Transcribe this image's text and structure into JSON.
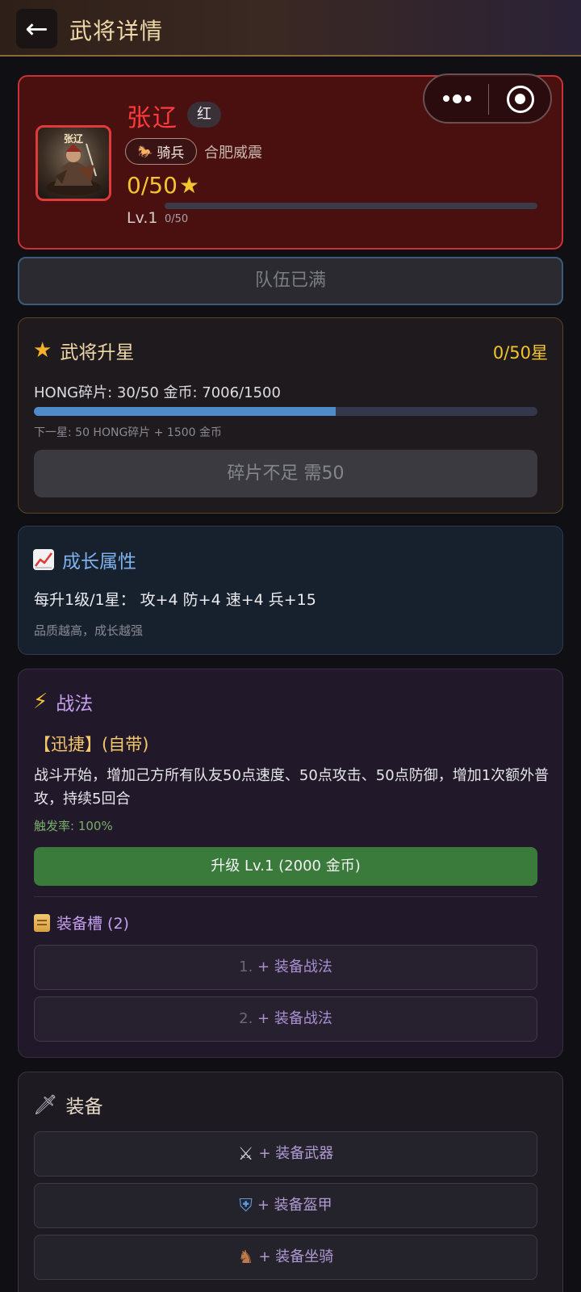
{
  "header": {
    "title": "武将详情"
  },
  "hero": {
    "name": "张辽",
    "portrait_name": "张辽",
    "quality": "红",
    "troop_type": "骑兵",
    "title": "合肥威震",
    "stars": "0/50",
    "level": "Lv.1",
    "xp_text": "0/50",
    "xp_fraction": 0
  },
  "team_button": "队伍已满",
  "star_up": {
    "title": "武将升星",
    "progress": "0/50星",
    "fragments_line": "HONG碎片: 30/50  金币: 7006/1500",
    "fragment_fraction": 0.6,
    "next_star": "下一星: 50 HONG碎片 + 1500 金币",
    "button": "碎片不足 需50"
  },
  "growth": {
    "title": "成长属性",
    "line": "每升1级/1星：  攻+4  防+4  速+4  兵+15",
    "note": "品质越高，成长越强"
  },
  "skill": {
    "title": "战法",
    "name": "【迅捷】(自带)",
    "description": "战斗开始，增加己方所有队友50点速度、50点攻击、50点防御，增加1次额外普攻，持续5回合",
    "trigger_rate": "触发率: 100%",
    "upgrade_button": "升级 Lv.1 (2000 金币)",
    "slots_title": "装备槽 (2)",
    "slots": [
      {
        "num": "1.",
        "label": "+ 装备战法"
      },
      {
        "num": "2.",
        "label": "+ 装备战法"
      }
    ]
  },
  "equipment": {
    "title": "装备",
    "items": [
      {
        "icon": "crossed-swords-icon",
        "label": "+ 装备武器"
      },
      {
        "icon": "shield-icon",
        "label": "+ 装备盔甲"
      },
      {
        "icon": "horse-icon",
        "label": "+ 装备坐骑"
      }
    ]
  },
  "colors": {
    "hero_red": "#ff3b3b",
    "gold": "#f4c430",
    "upgrade_green": "#3a7a3a"
  }
}
